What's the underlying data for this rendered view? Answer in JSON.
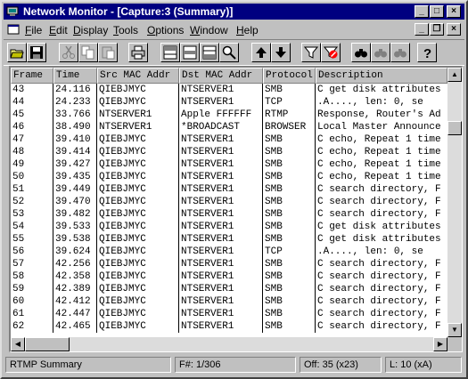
{
  "window": {
    "title": "Network Monitor - [Capture:3 (Summary)]"
  },
  "menu": {
    "items": [
      {
        "underline": "F",
        "rest": "ile"
      },
      {
        "underline": "E",
        "rest": "dit"
      },
      {
        "underline": "D",
        "rest": "isplay"
      },
      {
        "underline": "T",
        "rest": "ools"
      },
      {
        "underline": "O",
        "rest": "ptions"
      },
      {
        "underline": "W",
        "rest": "indow"
      },
      {
        "underline": "H",
        "rest": "elp"
      }
    ]
  },
  "toolbar": {
    "buttons": [
      "open-icon",
      "save-icon",
      "cut-icon",
      "copy-icon",
      "paste-icon",
      "print-icon",
      "pane-top-icon",
      "pane-middle-icon",
      "pane-bottom-icon",
      "zoom-icon",
      "arrow-up-icon",
      "arrow-down-icon",
      "filter-icon",
      "display-filter-icon",
      "find-icon",
      "find-next-icon",
      "find-previous-icon",
      "help-icon"
    ]
  },
  "table": {
    "columns": [
      "Frame",
      "Time",
      "Src MAC Addr",
      "Dst MAC Addr",
      "Protocol",
      "Description"
    ],
    "rows": [
      [
        "43",
        "24.116",
        "QIEBJMYC",
        "NTSERVER1",
        "SMB",
        "C get disk attributes"
      ],
      [
        "44",
        "24.233",
        "QIEBJMYC",
        "NTSERVER1",
        "TCP",
        ".A...., len:    0, se"
      ],
      [
        "45",
        "33.766",
        "NTSERVER1",
        "Apple FFFFFF",
        "RTMP",
        "Response, Router's Ad"
      ],
      [
        "46",
        "38.490",
        "NTSERVER1",
        "*BROADCAST",
        "BROWSER",
        "Local Master Announce"
      ],
      [
        "47",
        "39.410",
        "QIEBJMYC",
        "NTSERVER1",
        "SMB",
        "C echo, Repeat 1 time"
      ],
      [
        "48",
        "39.414",
        "QIEBJMYC",
        "NTSERVER1",
        "SMB",
        "C echo, Repeat 1 time"
      ],
      [
        "49",
        "39.427",
        "QIEBJMYC",
        "NTSERVER1",
        "SMB",
        "C echo, Repeat 1 time"
      ],
      [
        "50",
        "39.435",
        "QIEBJMYC",
        "NTSERVER1",
        "SMB",
        "C echo, Repeat 1 time"
      ],
      [
        "51",
        "39.449",
        "QIEBJMYC",
        "NTSERVER1",
        "SMB",
        "C search directory, F"
      ],
      [
        "52",
        "39.470",
        "QIEBJMYC",
        "NTSERVER1",
        "SMB",
        "C search directory, F"
      ],
      [
        "53",
        "39.482",
        "QIEBJMYC",
        "NTSERVER1",
        "SMB",
        "C search directory, F"
      ],
      [
        "54",
        "39.533",
        "QIEBJMYC",
        "NTSERVER1",
        "SMB",
        "C get disk attributes"
      ],
      [
        "55",
        "39.538",
        "QIEBJMYC",
        "NTSERVER1",
        "SMB",
        "C get disk attributes"
      ],
      [
        "56",
        "39.624",
        "QIEBJMYC",
        "NTSERVER1",
        "TCP",
        ".A...., len:    0, se"
      ],
      [
        "57",
        "42.256",
        "QIEBJMYC",
        "NTSERVER1",
        "SMB",
        "C search directory, F"
      ],
      [
        "58",
        "42.358",
        "QIEBJMYC",
        "NTSERVER1",
        "SMB",
        "C search directory, F"
      ],
      [
        "59",
        "42.389",
        "QIEBJMYC",
        "NTSERVER1",
        "SMB",
        "C search directory, F"
      ],
      [
        "60",
        "42.412",
        "QIEBJMYC",
        "NTSERVER1",
        "SMB",
        "C search directory, F"
      ],
      [
        "61",
        "42.447",
        "QIEBJMYC",
        "NTSERVER1",
        "SMB",
        "C search directory, F"
      ],
      [
        "62",
        "42.465",
        "QIEBJMYC",
        "NTSERVER1",
        "SMB",
        "C search directory, F"
      ]
    ]
  },
  "statusbar": {
    "summary": "RTMP Summary",
    "frame": "F#: 1/306",
    "offset": "Off: 35 (x23)",
    "length": "L: 10 (xA)"
  }
}
